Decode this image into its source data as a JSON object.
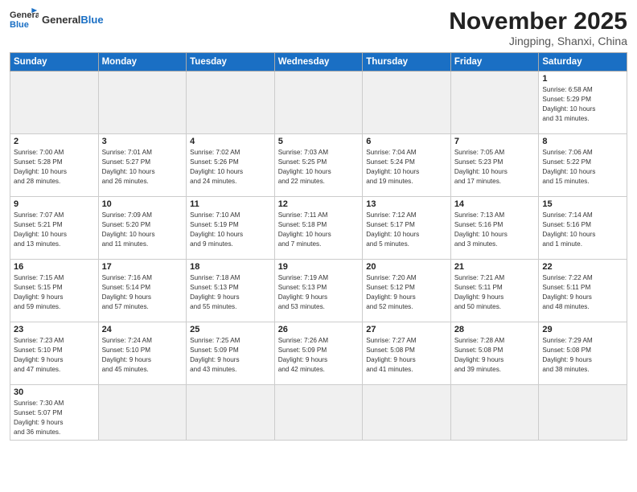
{
  "header": {
    "logo_general": "General",
    "logo_blue": "Blue",
    "month_title": "November 2025",
    "location": "Jingping, Shanxi, China"
  },
  "weekdays": [
    "Sunday",
    "Monday",
    "Tuesday",
    "Wednesday",
    "Thursday",
    "Friday",
    "Saturday"
  ],
  "weeks": [
    [
      {
        "day": "",
        "info": ""
      },
      {
        "day": "",
        "info": ""
      },
      {
        "day": "",
        "info": ""
      },
      {
        "day": "",
        "info": ""
      },
      {
        "day": "",
        "info": ""
      },
      {
        "day": "",
        "info": ""
      },
      {
        "day": "1",
        "info": "Sunrise: 6:58 AM\nSunset: 5:29 PM\nDaylight: 10 hours\nand 31 minutes."
      }
    ],
    [
      {
        "day": "2",
        "info": "Sunrise: 7:00 AM\nSunset: 5:28 PM\nDaylight: 10 hours\nand 28 minutes."
      },
      {
        "day": "3",
        "info": "Sunrise: 7:01 AM\nSunset: 5:27 PM\nDaylight: 10 hours\nand 26 minutes."
      },
      {
        "day": "4",
        "info": "Sunrise: 7:02 AM\nSunset: 5:26 PM\nDaylight: 10 hours\nand 24 minutes."
      },
      {
        "day": "5",
        "info": "Sunrise: 7:03 AM\nSunset: 5:25 PM\nDaylight: 10 hours\nand 22 minutes."
      },
      {
        "day": "6",
        "info": "Sunrise: 7:04 AM\nSunset: 5:24 PM\nDaylight: 10 hours\nand 19 minutes."
      },
      {
        "day": "7",
        "info": "Sunrise: 7:05 AM\nSunset: 5:23 PM\nDaylight: 10 hours\nand 17 minutes."
      },
      {
        "day": "8",
        "info": "Sunrise: 7:06 AM\nSunset: 5:22 PM\nDaylight: 10 hours\nand 15 minutes."
      }
    ],
    [
      {
        "day": "9",
        "info": "Sunrise: 7:07 AM\nSunset: 5:21 PM\nDaylight: 10 hours\nand 13 minutes."
      },
      {
        "day": "10",
        "info": "Sunrise: 7:09 AM\nSunset: 5:20 PM\nDaylight: 10 hours\nand 11 minutes."
      },
      {
        "day": "11",
        "info": "Sunrise: 7:10 AM\nSunset: 5:19 PM\nDaylight: 10 hours\nand 9 minutes."
      },
      {
        "day": "12",
        "info": "Sunrise: 7:11 AM\nSunset: 5:18 PM\nDaylight: 10 hours\nand 7 minutes."
      },
      {
        "day": "13",
        "info": "Sunrise: 7:12 AM\nSunset: 5:17 PM\nDaylight: 10 hours\nand 5 minutes."
      },
      {
        "day": "14",
        "info": "Sunrise: 7:13 AM\nSunset: 5:16 PM\nDaylight: 10 hours\nand 3 minutes."
      },
      {
        "day": "15",
        "info": "Sunrise: 7:14 AM\nSunset: 5:16 PM\nDaylight: 10 hours\nand 1 minute."
      }
    ],
    [
      {
        "day": "16",
        "info": "Sunrise: 7:15 AM\nSunset: 5:15 PM\nDaylight: 9 hours\nand 59 minutes."
      },
      {
        "day": "17",
        "info": "Sunrise: 7:16 AM\nSunset: 5:14 PM\nDaylight: 9 hours\nand 57 minutes."
      },
      {
        "day": "18",
        "info": "Sunrise: 7:18 AM\nSunset: 5:13 PM\nDaylight: 9 hours\nand 55 minutes."
      },
      {
        "day": "19",
        "info": "Sunrise: 7:19 AM\nSunset: 5:13 PM\nDaylight: 9 hours\nand 53 minutes."
      },
      {
        "day": "20",
        "info": "Sunrise: 7:20 AM\nSunset: 5:12 PM\nDaylight: 9 hours\nand 52 minutes."
      },
      {
        "day": "21",
        "info": "Sunrise: 7:21 AM\nSunset: 5:11 PM\nDaylight: 9 hours\nand 50 minutes."
      },
      {
        "day": "22",
        "info": "Sunrise: 7:22 AM\nSunset: 5:11 PM\nDaylight: 9 hours\nand 48 minutes."
      }
    ],
    [
      {
        "day": "23",
        "info": "Sunrise: 7:23 AM\nSunset: 5:10 PM\nDaylight: 9 hours\nand 47 minutes."
      },
      {
        "day": "24",
        "info": "Sunrise: 7:24 AM\nSunset: 5:10 PM\nDaylight: 9 hours\nand 45 minutes."
      },
      {
        "day": "25",
        "info": "Sunrise: 7:25 AM\nSunset: 5:09 PM\nDaylight: 9 hours\nand 43 minutes."
      },
      {
        "day": "26",
        "info": "Sunrise: 7:26 AM\nSunset: 5:09 PM\nDaylight: 9 hours\nand 42 minutes."
      },
      {
        "day": "27",
        "info": "Sunrise: 7:27 AM\nSunset: 5:08 PM\nDaylight: 9 hours\nand 41 minutes."
      },
      {
        "day": "28",
        "info": "Sunrise: 7:28 AM\nSunset: 5:08 PM\nDaylight: 9 hours\nand 39 minutes."
      },
      {
        "day": "29",
        "info": "Sunrise: 7:29 AM\nSunset: 5:08 PM\nDaylight: 9 hours\nand 38 minutes."
      }
    ],
    [
      {
        "day": "30",
        "info": "Sunrise: 7:30 AM\nSunset: 5:07 PM\nDaylight: 9 hours\nand 36 minutes."
      },
      {
        "day": "",
        "info": ""
      },
      {
        "day": "",
        "info": ""
      },
      {
        "day": "",
        "info": ""
      },
      {
        "day": "",
        "info": ""
      },
      {
        "day": "",
        "info": ""
      },
      {
        "day": "",
        "info": ""
      }
    ]
  ]
}
